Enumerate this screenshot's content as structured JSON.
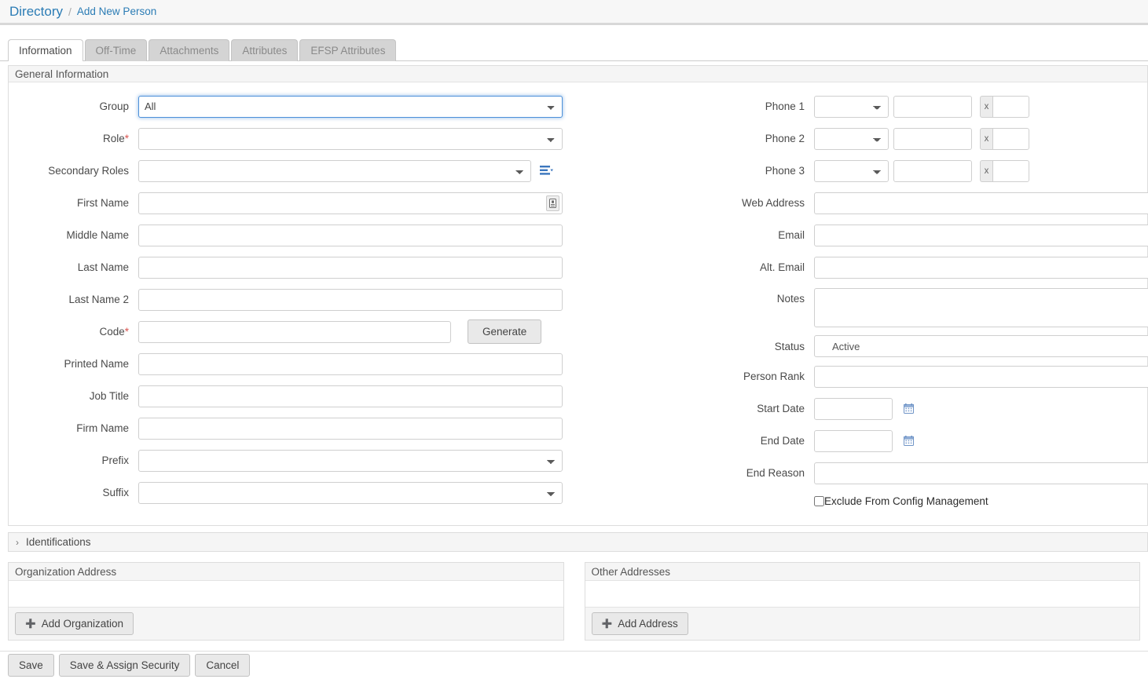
{
  "breadcrumb": {
    "root": "Directory",
    "separator": "/",
    "current": "Add New Person"
  },
  "tabs": [
    {
      "label": "Information",
      "active": true
    },
    {
      "label": "Off-Time",
      "active": false
    },
    {
      "label": "Attachments",
      "active": false
    },
    {
      "label": "Attributes",
      "active": false
    },
    {
      "label": "EFSP Attributes",
      "active": false
    }
  ],
  "general": {
    "legend": "General Information",
    "left": {
      "group_label": "Group",
      "group_value": "All",
      "role_label": "Role",
      "role_required": "*",
      "role_value": "",
      "secondary_roles_label": "Secondary Roles",
      "secondary_roles_value": "",
      "secondary_roles_icon": "list-options-icon",
      "first_name_label": "First Name",
      "first_name_value": "",
      "first_name_icon": "id-card-icon",
      "middle_name_label": "Middle Name",
      "middle_name_value": "",
      "last_name_label": "Last Name",
      "last_name_value": "",
      "last_name_2_label": "Last Name 2",
      "last_name_2_value": "",
      "code_label": "Code",
      "code_required": "*",
      "code_value": "",
      "generate_label": "Generate",
      "printed_name_label": "Printed Name",
      "printed_name_value": "",
      "job_title_label": "Job Title",
      "job_title_value": "",
      "firm_name_label": "Firm Name",
      "firm_name_value": "",
      "prefix_label": "Prefix",
      "prefix_value": "",
      "suffix_label": "Suffix",
      "suffix_value": ""
    },
    "right": {
      "phone1_label": "Phone 1",
      "phone1_type": "",
      "phone1_number": "",
      "phone1_ext_prefix": "x",
      "phone1_ext": "",
      "phone2_label": "Phone 2",
      "phone2_type": "",
      "phone2_number": "",
      "phone2_ext_prefix": "x",
      "phone2_ext": "",
      "phone3_label": "Phone 3",
      "phone3_type": "",
      "phone3_number": "",
      "phone3_ext_prefix": "x",
      "phone3_ext": "",
      "web_address_label": "Web Address",
      "web_address_value": "",
      "email_label": "Email",
      "email_value": "",
      "alt_email_label": "Alt. Email",
      "alt_email_value": "",
      "notes_label": "Notes",
      "notes_value": "",
      "status_label": "Status",
      "status_value": "Active",
      "person_rank_label": "Person Rank",
      "person_rank_value": "",
      "start_date_label": "Start Date",
      "start_date_value": "",
      "start_date_icon": "calendar-icon",
      "end_date_label": "End Date",
      "end_date_value": "",
      "end_date_icon": "calendar-icon",
      "end_reason_label": "End Reason",
      "end_reason_value": "",
      "exclude_label": "Exclude From Config Management",
      "exclude_checked": false
    }
  },
  "identifications": {
    "title": "Identifications",
    "chevron": "›",
    "expanded": false
  },
  "addresses": {
    "organization": {
      "title": "Organization Address",
      "add_label": "Add Organization",
      "add_icon": "plus-circle-icon"
    },
    "other": {
      "title": "Other Addresses",
      "add_label": "Add Address",
      "add_icon": "plus-circle-icon"
    }
  },
  "footer": {
    "save": "Save",
    "save_assign": "Save & Assign Security",
    "cancel": "Cancel"
  },
  "colors": {
    "link": "#2b7cb5",
    "required": "#d9534f",
    "focus_border": "#4d90d9",
    "panel_head_bg": "#f5f5f5",
    "tab_inactive_bg": "#d4d4d4",
    "icon_blue": "#3b76bd"
  }
}
